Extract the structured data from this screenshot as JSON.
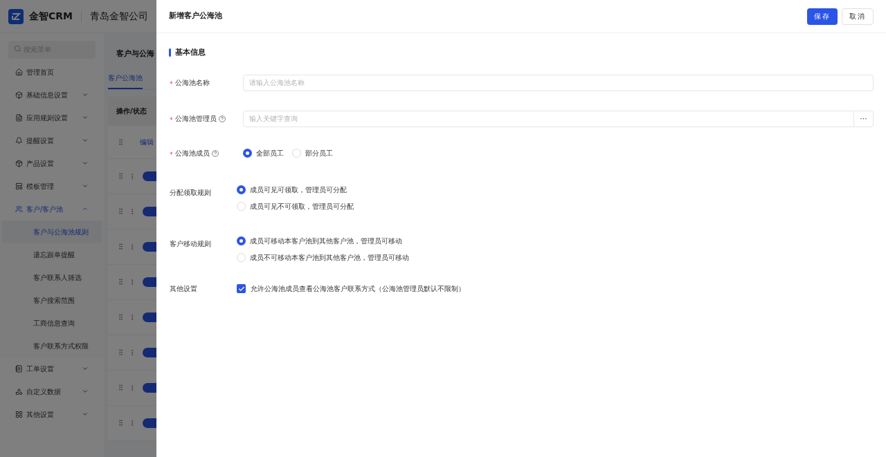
{
  "app": {
    "logo_text": "金智CRM",
    "company": "青岛金智公司"
  },
  "sidebar": {
    "search_placeholder": "搜索菜单",
    "items": [
      {
        "label": "管理首页",
        "selected": false
      },
      {
        "label": "基础信息设置",
        "selected": false,
        "expanded": false
      },
      {
        "label": "应用规则设置",
        "selected": false,
        "expanded": false
      },
      {
        "label": "提醒设置",
        "selected": false,
        "expanded": false
      },
      {
        "label": "产品设置",
        "selected": false,
        "expanded": false
      },
      {
        "label": "模板管理",
        "selected": false,
        "expanded": false
      },
      {
        "label": "客户/客户池",
        "selected": true,
        "expanded": true,
        "children": [
          {
            "label": "客户与公海池规则",
            "selected": true
          },
          {
            "label": "遗忘跟单提醒",
            "selected": false
          },
          {
            "label": "客户联系人筛选",
            "selected": false
          },
          {
            "label": "客户搜索范围",
            "selected": false
          },
          {
            "label": "工商信息查询",
            "selected": false
          },
          {
            "label": "客户联系方式权限",
            "selected": false
          }
        ]
      },
      {
        "label": "工单设置",
        "selected": false,
        "expanded": false
      },
      {
        "label": "自定义数据",
        "selected": false,
        "expanded": false
      },
      {
        "label": "其他设置",
        "selected": false,
        "expanded": false
      }
    ]
  },
  "content": {
    "title": "客户与公海",
    "tabs": [
      {
        "label": "客户公海池",
        "selected": true
      }
    ],
    "column": "操作/状态",
    "rows": [
      {
        "kind": "link",
        "action": "编辑"
      },
      {
        "kind": "toggle",
        "on": true
      },
      {
        "kind": "toggle",
        "on": true
      },
      {
        "kind": "toggle",
        "on": true
      },
      {
        "kind": "toggle",
        "on": true
      },
      {
        "kind": "toggle",
        "on": true
      },
      {
        "kind": "toggle",
        "on": true
      },
      {
        "kind": "toggle",
        "on": true
      },
      {
        "kind": "toggle",
        "on": true
      }
    ]
  },
  "drawer": {
    "title": "新增客户公海池",
    "buttons": [
      {
        "label": "保存",
        "kind": "primary"
      },
      {
        "label": "取消",
        "kind": "default"
      }
    ],
    "section": "基本信息",
    "fields": [
      {
        "kind": "text",
        "label": "公海池名称",
        "required": true,
        "help": false,
        "placeholder": "请输入公海池名称"
      },
      {
        "kind": "picker",
        "label": "公海池管理员",
        "required": true,
        "help": true,
        "placeholder": "输入关键字查询",
        "button": "···"
      },
      {
        "kind": "radio_inline",
        "label": "公海池成员",
        "required": true,
        "help": true,
        "options": [
          {
            "label": "全部员工",
            "selected": true
          },
          {
            "label": "部分员工",
            "selected": false
          }
        ]
      },
      {
        "kind": "radio_stack",
        "label": "分配领取规则",
        "required": false,
        "help": false,
        "options": [
          {
            "label": "成员可见可领取，管理员可分配",
            "selected": true
          },
          {
            "label": "成员可见不可领取，管理员可分配",
            "selected": false
          }
        ]
      },
      {
        "kind": "radio_stack",
        "label": "客户移动规则",
        "required": false,
        "help": false,
        "options": [
          {
            "label": "成员可移动本客户池到其他客户池，管理员可移动",
            "selected": true
          },
          {
            "label": "成员不可移动本客户池到其他客户池，管理员可移动",
            "selected": false
          }
        ]
      },
      {
        "kind": "checkbox",
        "label": "其他设置",
        "required": false,
        "help": false,
        "option": "允许公海池成员查看公海池客户联系方式（公海池管理员默认不限制）",
        "checked": true
      }
    ]
  }
}
